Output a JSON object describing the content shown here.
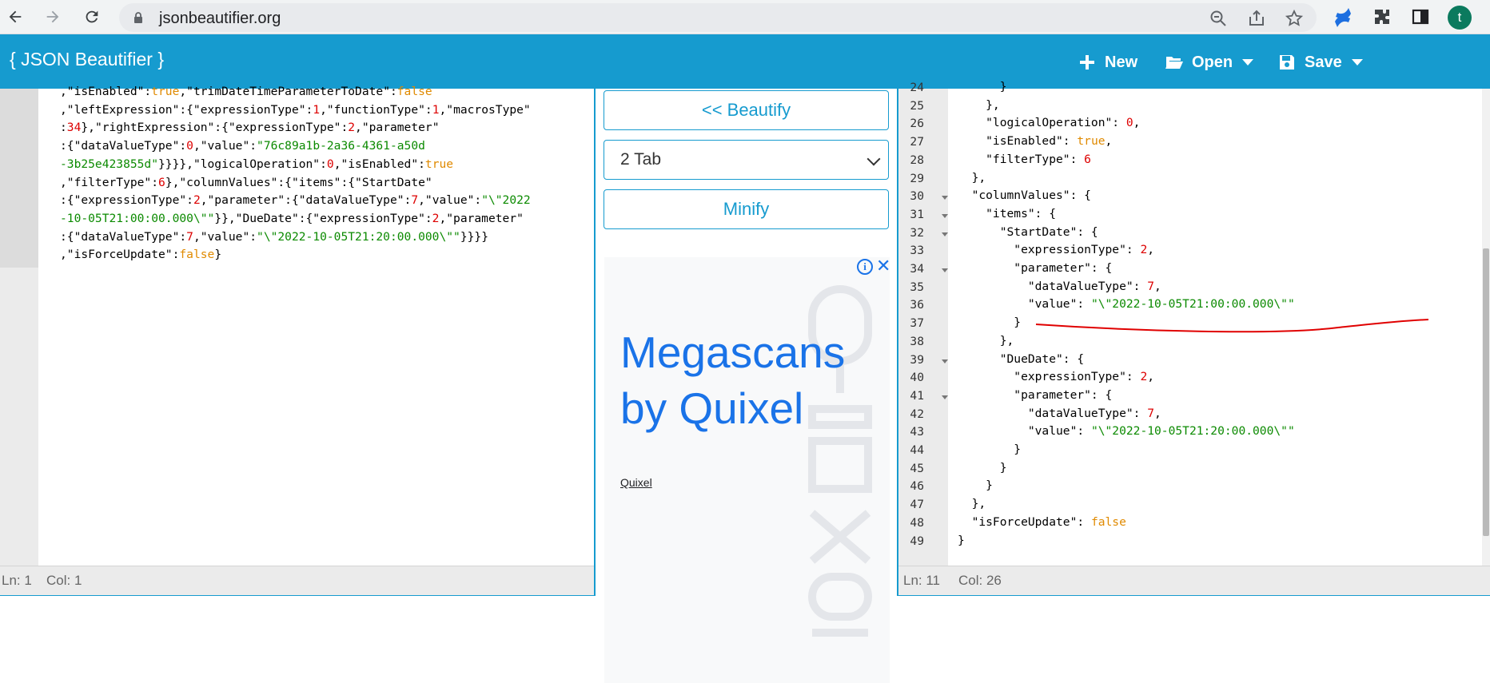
{
  "browser": {
    "url": "jsonbeautifier.org",
    "profile_initial": "t"
  },
  "header": {
    "brand": "{ JSON Beautifier }",
    "new_label": "New",
    "open_label": "Open",
    "save_label": "Save"
  },
  "left_editor": {
    "lines": [
      [
        [
          ",\"isEnabled\":",
          "k"
        ],
        [
          "true",
          "b"
        ],
        [
          ",\"trimDateTimeParameterToDate\":",
          "k"
        ],
        [
          "false",
          "b"
        ]
      ],
      [
        [
          ",\"leftExpression\":{\"expressionType\":",
          "k"
        ],
        [
          "1",
          "n"
        ],
        [
          ",\"functionType\":",
          "k"
        ],
        [
          "1",
          "n"
        ],
        [
          ",\"macrosType\"",
          "k"
        ]
      ],
      [
        [
          ":",
          "k"
        ],
        [
          "34",
          "n"
        ],
        [
          "},\"rightExpression\":{\"expressionType\":",
          "k"
        ],
        [
          "2",
          "n"
        ],
        [
          ",\"parameter\"",
          "k"
        ]
      ],
      [
        [
          ":{\"dataValueType\":",
          "k"
        ],
        [
          "0",
          "n"
        ],
        [
          ",\"value\":",
          "k"
        ],
        [
          "\"76c89a1b-2a36-4361-a50d",
          "s"
        ]
      ],
      [
        [
          "-3b25e423855d\"",
          "s"
        ],
        [
          "}}}},\"logicalOperation\":",
          "k"
        ],
        [
          "0",
          "n"
        ],
        [
          ",\"isEnabled\":",
          "k"
        ],
        [
          "true",
          "b"
        ]
      ],
      [
        [
          ",\"filterType\":",
          "k"
        ],
        [
          "6",
          "n"
        ],
        [
          "},\"columnValues\":{\"items\":{\"StartDate\"",
          "k"
        ]
      ],
      [
        [
          ":{\"expressionType\":",
          "k"
        ],
        [
          "2",
          "n"
        ],
        [
          ",\"parameter\":{\"dataValueType\":",
          "k"
        ],
        [
          "7",
          "n"
        ],
        [
          ",\"value\":",
          "k"
        ],
        [
          "\"\\\"2022",
          "s"
        ]
      ],
      [
        [
          "-10-05T21:00:00.000\\\"\"",
          "s"
        ],
        [
          "}},\"DueDate\":{\"expressionType\":",
          "k"
        ],
        [
          "2",
          "n"
        ],
        [
          ",\"parameter\"",
          "k"
        ]
      ],
      [
        [
          ":{\"dataValueType\":",
          "k"
        ],
        [
          "7",
          "n"
        ],
        [
          ",\"value\":",
          "k"
        ],
        [
          "\"\\\"2022-10-05T21:20:00.000\\\"\"",
          "s"
        ],
        [
          "}}}}",
          "k"
        ]
      ],
      [
        [
          ",\"isForceUpdate\":",
          "k"
        ],
        [
          "false",
          "b"
        ],
        [
          "}",
          "k"
        ]
      ]
    ],
    "status_ln": "Ln: 1",
    "status_col": "Col: 1"
  },
  "middle": {
    "beautify_label": "<< Beautify",
    "indent_selected": "2 Tab",
    "minify_label": "Minify",
    "ad_title_line1": "Megascans",
    "ad_title_line2": "by Quixel",
    "ad_link": "Quixel",
    "ad_info": "i",
    "ad_close": "✕"
  },
  "right_editor": {
    "lines": [
      {
        "num": "24",
        "fold": false,
        "parts": [
          [
            "      }",
            "k"
          ]
        ]
      },
      {
        "num": "25",
        "fold": false,
        "parts": [
          [
            "    },",
            "k"
          ]
        ]
      },
      {
        "num": "26",
        "fold": false,
        "parts": [
          [
            "    \"logicalOperation\": ",
            "k"
          ],
          [
            "0",
            "n"
          ],
          [
            ",",
            "k"
          ]
        ]
      },
      {
        "num": "27",
        "fold": false,
        "parts": [
          [
            "    \"isEnabled\": ",
            "k"
          ],
          [
            "true",
            "b"
          ],
          [
            ",",
            "k"
          ]
        ]
      },
      {
        "num": "28",
        "fold": false,
        "parts": [
          [
            "    \"filterType\": ",
            "k"
          ],
          [
            "6",
            "n"
          ]
        ]
      },
      {
        "num": "29",
        "fold": false,
        "parts": [
          [
            "  },",
            "k"
          ]
        ]
      },
      {
        "num": "30",
        "fold": true,
        "parts": [
          [
            "  \"columnValues\": {",
            "k"
          ]
        ]
      },
      {
        "num": "31",
        "fold": true,
        "parts": [
          [
            "    \"items\": {",
            "k"
          ]
        ]
      },
      {
        "num": "32",
        "fold": true,
        "parts": [
          [
            "      \"StartDate\": {",
            "k"
          ]
        ]
      },
      {
        "num": "33",
        "fold": false,
        "parts": [
          [
            "        \"expressionType\": ",
            "k"
          ],
          [
            "2",
            "n"
          ],
          [
            ",",
            "k"
          ]
        ]
      },
      {
        "num": "34",
        "fold": true,
        "parts": [
          [
            "        \"parameter\": {",
            "k"
          ]
        ]
      },
      {
        "num": "35",
        "fold": false,
        "parts": [
          [
            "          \"dataValueType\": ",
            "k"
          ],
          [
            "7",
            "n"
          ],
          [
            ",",
            "k"
          ]
        ]
      },
      {
        "num": "36",
        "fold": false,
        "parts": [
          [
            "          \"value\": ",
            "k"
          ],
          [
            "\"\\\"2022-10-05T21:00:00.000\\\"\"",
            "s"
          ]
        ]
      },
      {
        "num": "37",
        "fold": false,
        "parts": [
          [
            "        }",
            "k"
          ]
        ]
      },
      {
        "num": "38",
        "fold": false,
        "parts": [
          [
            "      },",
            "k"
          ]
        ]
      },
      {
        "num": "39",
        "fold": true,
        "parts": [
          [
            "      \"DueDate\": {",
            "k"
          ]
        ]
      },
      {
        "num": "40",
        "fold": false,
        "parts": [
          [
            "        \"expressionType\": ",
            "k"
          ],
          [
            "2",
            "n"
          ],
          [
            ",",
            "k"
          ]
        ]
      },
      {
        "num": "41",
        "fold": true,
        "parts": [
          [
            "        \"parameter\": {",
            "k"
          ]
        ]
      },
      {
        "num": "42",
        "fold": false,
        "parts": [
          [
            "          \"dataValueType\": ",
            "k"
          ],
          [
            "7",
            "n"
          ],
          [
            ",",
            "k"
          ]
        ]
      },
      {
        "num": "43",
        "fold": false,
        "parts": [
          [
            "          \"value\": ",
            "k"
          ],
          [
            "\"\\\"2022-10-05T21:20:00.000\\\"\"",
            "s"
          ]
        ]
      },
      {
        "num": "44",
        "fold": false,
        "parts": [
          [
            "        }",
            "k"
          ]
        ]
      },
      {
        "num": "45",
        "fold": false,
        "parts": [
          [
            "      }",
            "k"
          ]
        ]
      },
      {
        "num": "46",
        "fold": false,
        "parts": [
          [
            "    }",
            "k"
          ]
        ]
      },
      {
        "num": "47",
        "fold": false,
        "parts": [
          [
            "  },",
            "k"
          ]
        ]
      },
      {
        "num": "48",
        "fold": false,
        "parts": [
          [
            "  \"isForceUpdate\": ",
            "k"
          ],
          [
            "false",
            "b"
          ]
        ]
      },
      {
        "num": "49",
        "fold": false,
        "parts": [
          [
            "}",
            "k"
          ]
        ]
      }
    ],
    "status_ln": "Ln: 11",
    "status_col": "Col: 26"
  },
  "colors": {
    "accent": "#169bcf",
    "string": "#0b8a00",
    "number": "#d00000",
    "boolean": "#e08a00",
    "annotation": "#e00000"
  }
}
